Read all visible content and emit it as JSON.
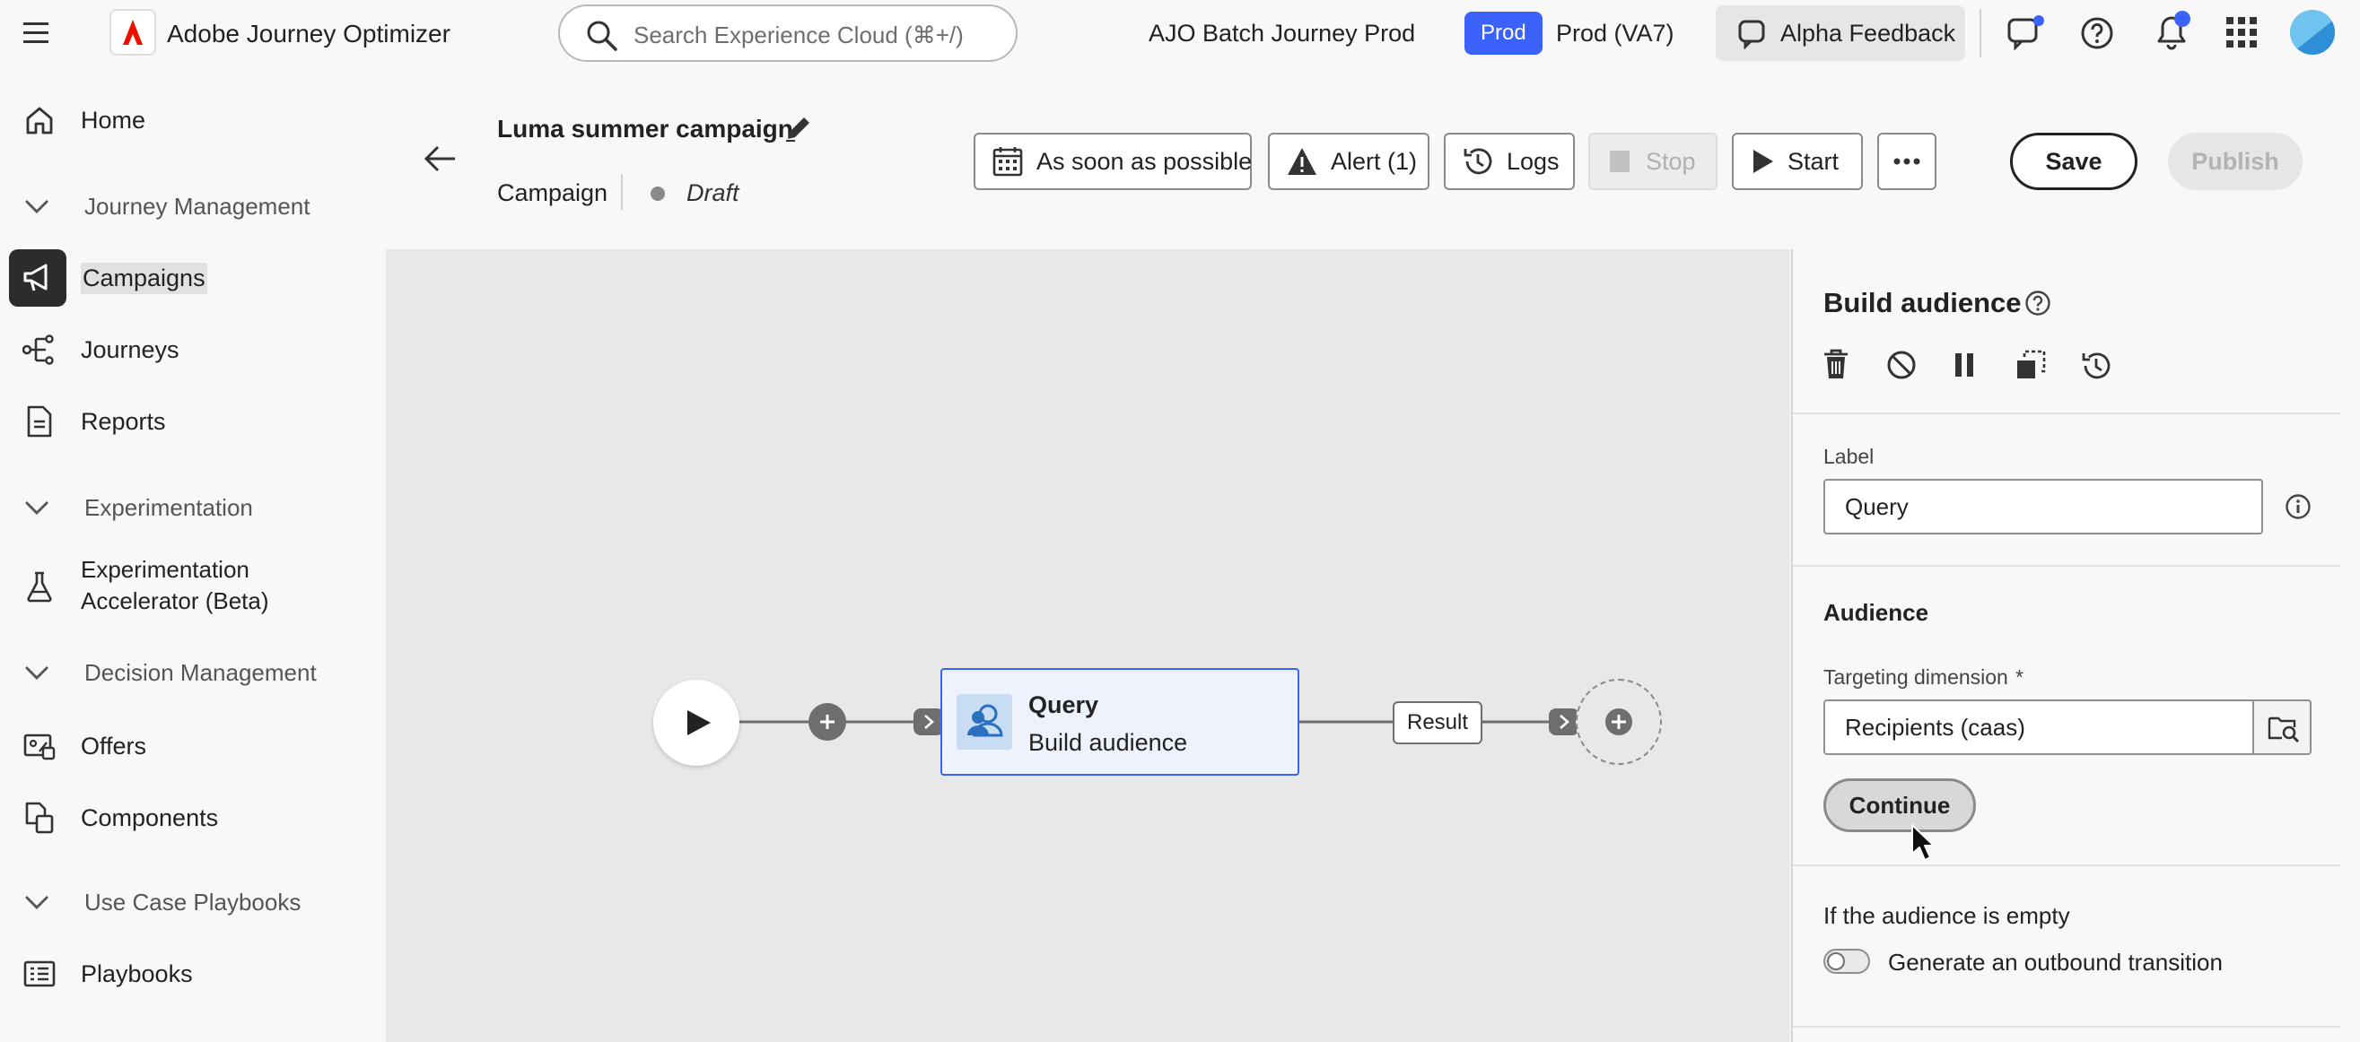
{
  "app": {
    "name": "Adobe Journey Optimizer",
    "search_placeholder": "Search Experience Cloud (⌘+/)",
    "org": "AJO Batch Journey Prod",
    "env_badge": "Prod",
    "env_name": "Prod (VA7)",
    "feedback_label": "Alpha Feedback",
    "brand_color": "#eb1000",
    "accent_color": "#3b63fb"
  },
  "sidebar": {
    "home": "Home",
    "journey_management": "Journey Management",
    "campaigns": "Campaigns",
    "journeys": "Journeys",
    "reports": "Reports",
    "experimentation": "Experimentation",
    "exp_accel_line1": "Experimentation",
    "exp_accel_line2": "Accelerator (Beta)",
    "decision_management": "Decision Management",
    "offers": "Offers",
    "components": "Components",
    "use_case_playbooks": "Use Case Playbooks",
    "playbooks": "Playbooks"
  },
  "header": {
    "title": "Luma summer campaign",
    "type": "Campaign",
    "status": "Draft",
    "schedule_label": "As soon as possible",
    "alert_label": "Alert (1)",
    "logs_label": "Logs",
    "stop_label": "Stop",
    "start_label": "Start",
    "save_label": "Save",
    "publish_label": "Publish"
  },
  "canvas": {
    "node_title": "Query",
    "node_subtitle": "Build audience",
    "result_label": "Result"
  },
  "panel": {
    "title": "Build audience",
    "label_caption": "Label",
    "label_value": "Query",
    "audience_heading": "Audience",
    "targeting_caption": "Targeting dimension",
    "required_mark": "*",
    "targeting_value": "Recipients (caas)",
    "continue_label": "Continue",
    "empty_heading": "If the audience is empty",
    "outbound_label": "Generate an outbound transition"
  }
}
